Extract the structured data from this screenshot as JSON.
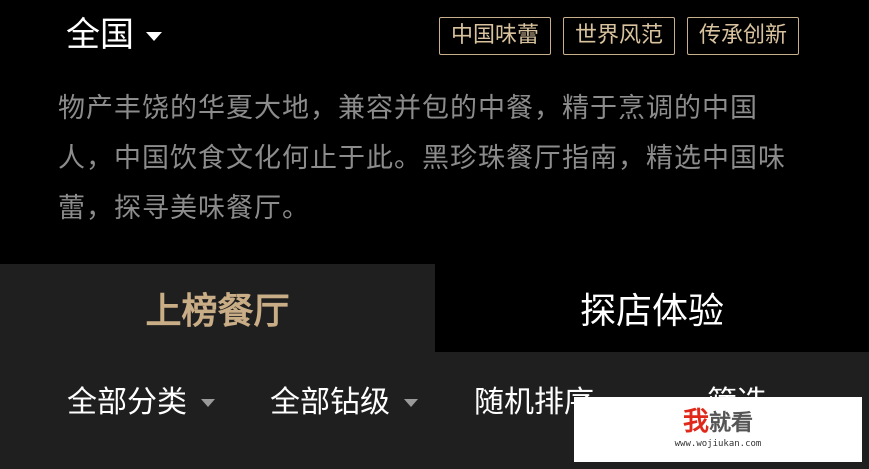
{
  "header": {
    "region": "全国",
    "tags": [
      "中国味蕾",
      "世界风范",
      "传承创新"
    ],
    "intro": "物产丰饶的华夏大地，兼容并包的中餐，精于烹调的中国人，中国饮食文化何止于此。黑珍珠餐厅指南，精选中国味蕾，探寻美味餐厅。"
  },
  "tabs": {
    "active": "上榜餐厅",
    "inactive": "探店体验"
  },
  "filters": {
    "category": "全部分类",
    "level": "全部钻级",
    "sort": "随机排序",
    "filter": "筛选"
  },
  "watermark": {
    "logo_a": "我",
    "logo_b": "就看",
    "url": "www.wojiukan.com"
  },
  "colors": {
    "background": "#000000",
    "panel": "#1f1f1f",
    "accent_gold": "#c9ad86",
    "muted_text": "#8c8c8c"
  }
}
